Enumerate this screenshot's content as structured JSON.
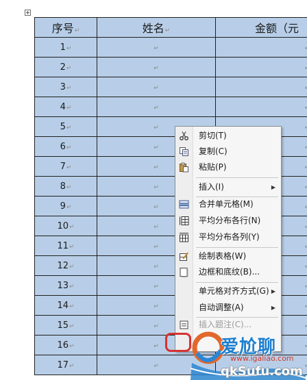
{
  "table": {
    "headers": [
      "序号",
      "姓名",
      "金额（元"
    ],
    "cell_mark": "↵",
    "rows": [
      "1",
      "2",
      "3",
      "4",
      "5",
      "6",
      "7",
      "8",
      "9",
      "10",
      "11",
      "12",
      "13",
      "14",
      "15",
      "16",
      "17"
    ]
  },
  "context_menu": {
    "items": [
      {
        "label": "剪切(T)",
        "icon": "scissors-icon"
      },
      {
        "label": "复制(C)",
        "icon": "copy-icon"
      },
      {
        "label": "粘贴(P)",
        "icon": "paste-icon"
      },
      {
        "label": "插入(I)",
        "submenu": true
      },
      {
        "label": "合并单元格(M)",
        "icon": "merge-cells-icon"
      },
      {
        "label": "平均分布各行(N)",
        "icon": "distribute-rows-icon"
      },
      {
        "label": "平均分布各列(Y)",
        "icon": "distribute-columns-icon"
      },
      {
        "label": "绘制表格(W)",
        "icon": "draw-table-icon"
      },
      {
        "label": "边框和底纹(B)...",
        "icon": "borders-shading-icon"
      },
      {
        "label": "单元格对齐方式(G)",
        "submenu": true
      },
      {
        "label": "自动调整(A)",
        "submenu": true
      },
      {
        "label": "插入题注(C)...",
        "icon": "caption-icon"
      }
    ]
  },
  "watermark": {
    "line1": "爱尬聊",
    "line2": "www.igaliao.com",
    "line3": "qkSufu.com"
  }
}
